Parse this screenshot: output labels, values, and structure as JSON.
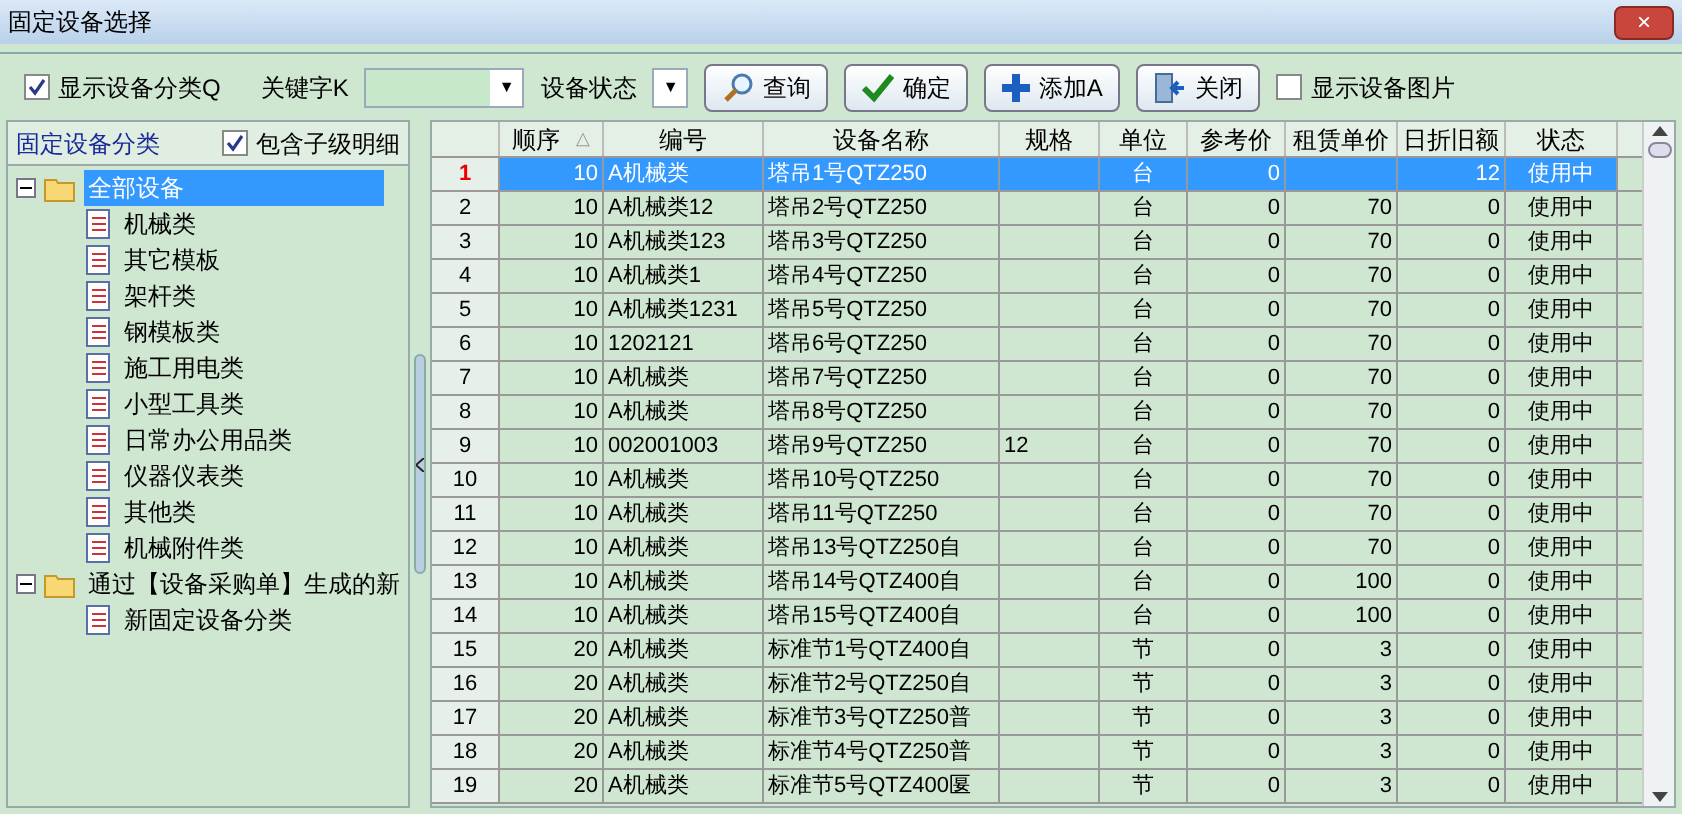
{
  "window": {
    "title": "固定设备选择",
    "close": "×"
  },
  "toolbar": {
    "show_category": {
      "label": "显示设备分类Q",
      "checked": true
    },
    "keyword_label": "关键字K",
    "status_label": "设备状态",
    "dropdown_arrow": "▼",
    "buttons": [
      {
        "kind": "search",
        "label": "查询"
      },
      {
        "kind": "ok",
        "label": "确定"
      },
      {
        "kind": "add",
        "label": "添加A"
      },
      {
        "kind": "close",
        "label": "关闭"
      }
    ],
    "show_picture": {
      "label": "显示设备图片",
      "checked": false
    }
  },
  "sidebar": {
    "title": "固定设备分类",
    "include_children": {
      "label": "包含子级明细",
      "checked": true
    },
    "tree": [
      {
        "label": "全部设备",
        "expanded": true,
        "selected": true,
        "children": [
          {
            "label": "机械类",
            "selected": false
          },
          {
            "label": "其它模板",
            "selected": false
          },
          {
            "label": "架杆类",
            "selected": false
          },
          {
            "label": "钢模板类",
            "selected": false
          },
          {
            "label": "施工用电类",
            "selected": false
          },
          {
            "label": "小型工具类",
            "selected": false
          },
          {
            "label": "日常办公用品类",
            "selected": false
          },
          {
            "label": "仪器仪表类",
            "selected": false
          },
          {
            "label": "其他类",
            "selected": false
          },
          {
            "label": "机械附件类",
            "selected": false
          }
        ]
      },
      {
        "label": "通过【设备采购单】生成的新",
        "expanded": true,
        "selected": false,
        "children": [
          {
            "label": "新固定设备分类",
            "selected": false
          }
        ]
      }
    ]
  },
  "table": {
    "columns": [
      "顺序",
      "编号",
      "设备名称",
      "规格",
      "单位",
      "参考价",
      "租赁单价",
      "日折旧额",
      "状态"
    ],
    "sort_mark": "△",
    "rows": [
      {
        "no": "1",
        "selected": true,
        "cells": [
          "10",
          "A机械类",
          "塔吊1号QTZ250",
          null,
          "台",
          "0",
          null,
          "12",
          "使用中"
        ]
      },
      {
        "no": "2",
        "selected": false,
        "cells": [
          "10",
          "A机械类12",
          "塔吊2号QTZ250",
          null,
          "台",
          "0",
          "70",
          "0",
          "使用中"
        ]
      },
      {
        "no": "3",
        "selected": false,
        "cells": [
          "10",
          "A机械类123",
          "塔吊3号QTZ250",
          null,
          "台",
          "0",
          "70",
          "0",
          "使用中"
        ]
      },
      {
        "no": "4",
        "selected": false,
        "cells": [
          "10",
          "A机械类1",
          "塔吊4号QTZ250",
          null,
          "台",
          "0",
          "70",
          "0",
          "使用中"
        ]
      },
      {
        "no": "5",
        "selected": false,
        "cells": [
          "10",
          "A机械类1231",
          "塔吊5号QTZ250",
          null,
          "台",
          "0",
          "70",
          "0",
          "使用中"
        ]
      },
      {
        "no": "6",
        "selected": false,
        "cells": [
          "10",
          "1202121",
          "塔吊6号QTZ250",
          null,
          "台",
          "0",
          "70",
          "0",
          "使用中"
        ]
      },
      {
        "no": "7",
        "selected": false,
        "cells": [
          "10",
          "A机械类",
          "塔吊7号QTZ250",
          null,
          "台",
          "0",
          "70",
          "0",
          "使用中"
        ]
      },
      {
        "no": "8",
        "selected": false,
        "cells": [
          "10",
          "A机械类",
          "塔吊8号QTZ250",
          null,
          "台",
          "0",
          "70",
          "0",
          "使用中"
        ]
      },
      {
        "no": "9",
        "selected": false,
        "cells": [
          "10",
          "002001003",
          "塔吊9号QTZ250",
          "12",
          "台",
          "0",
          "70",
          "0",
          "使用中"
        ]
      },
      {
        "no": "10",
        "selected": false,
        "cells": [
          "10",
          "A机械类",
          "塔吊10号QTZ250",
          null,
          "台",
          "0",
          "70",
          "0",
          "使用中"
        ]
      },
      {
        "no": "11",
        "selected": false,
        "cells": [
          "10",
          "A机械类",
          "塔吊11号QTZ250",
          null,
          "台",
          "0",
          "70",
          "0",
          "使用中"
        ]
      },
      {
        "no": "12",
        "selected": false,
        "cells": [
          "10",
          "A机械类",
          "塔吊13号QTZ250自",
          null,
          "台",
          "0",
          "70",
          "0",
          "使用中"
        ]
      },
      {
        "no": "13",
        "selected": false,
        "cells": [
          "10",
          "A机械类",
          "塔吊14号QTZ400自",
          null,
          "台",
          "0",
          "100",
          "0",
          "使用中"
        ]
      },
      {
        "no": "14",
        "selected": false,
        "cells": [
          "10",
          "A机械类",
          "塔吊15号QTZ400自",
          null,
          "台",
          "0",
          "100",
          "0",
          "使用中"
        ]
      },
      {
        "no": "15",
        "selected": false,
        "cells": [
          "20",
          "A机械类",
          "标准节1号QTZ400自",
          null,
          "节",
          "0",
          "3",
          "0",
          "使用中"
        ]
      },
      {
        "no": "16",
        "selected": false,
        "cells": [
          "20",
          "A机械类",
          "标准节2号QTZ250自",
          null,
          "节",
          "0",
          "3",
          "0",
          "使用中"
        ]
      },
      {
        "no": "17",
        "selected": false,
        "cells": [
          "20",
          "A机械类",
          "标准节3号QTZ250普",
          null,
          "节",
          "0",
          "3",
          "0",
          "使用中"
        ]
      },
      {
        "no": "18",
        "selected": false,
        "cells": [
          "20",
          "A机械类",
          "标准节4号QTZ250普",
          null,
          "节",
          "0",
          "3",
          "0",
          "使用中"
        ]
      },
      {
        "no": "19",
        "selected": false,
        "cells": [
          "20",
          "A机械类",
          "标准节5号QTZ400匽",
          null,
          "节",
          "0",
          "3",
          "0",
          "使用中"
        ]
      }
    ]
  }
}
